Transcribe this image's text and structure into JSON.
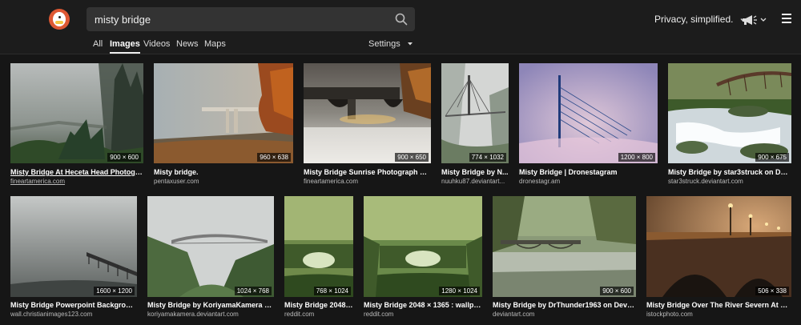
{
  "search": {
    "query": "misty bridge"
  },
  "header": {
    "privacy_label": "Privacy, simplified."
  },
  "tabs": [
    {
      "label": "All"
    },
    {
      "label": "Images"
    },
    {
      "label": "Videos"
    },
    {
      "label": "News"
    },
    {
      "label": "Maps"
    }
  ],
  "settings_label": "Settings",
  "results": [
    {
      "title": "Misty Bridge At Heceta Head Photogra...",
      "domain": "fineartamerica.com",
      "dim": "900 × 600"
    },
    {
      "title": "Misty bridge.",
      "domain": "pentaxuser.com",
      "dim": "960 × 638"
    },
    {
      "title": "Misty Bridge Sunrise Photograph by ...",
      "domain": "fineartamerica.com",
      "dim": "900 × 650"
    },
    {
      "title": "Misty Bridge by N...",
      "domain": "nuuhku87.deviantart...",
      "dim": "774 × 1032"
    },
    {
      "title": "Misty Bridge | Dronestagram",
      "domain": "dronestagr.am",
      "dim": "1200 × 800"
    },
    {
      "title": "Misty Bridge by star3struck on Devi...",
      "domain": "star3struck.deviantart.com",
      "dim": "900 × 675"
    },
    {
      "title": "Misty Bridge Powerpoint Backgroun...",
      "domain": "wall.christianimages123.com",
      "dim": "1600 × 1200"
    },
    {
      "title": "Misty Bridge by KoriyamaKamera on ...",
      "domain": "koriyamakamera.deviantart.com",
      "dim": "1024 × 768"
    },
    {
      "title": "Misty Bridge 2048 ...",
      "domain": "reddit.com",
      "dim": "768 × 1024"
    },
    {
      "title": "Misty Bridge 2048 × 1365 : wallpa...",
      "domain": "reddit.com",
      "dim": "1280 × 1024"
    },
    {
      "title": "Misty Bridge by DrThunder1963 on Devia...",
      "domain": "deviantart.com",
      "dim": "900 × 600"
    },
    {
      "title": "Misty Bridge Over The River Severn At Wo...",
      "domain": "istockphoto.com",
      "dim": "506 × 338"
    }
  ]
}
